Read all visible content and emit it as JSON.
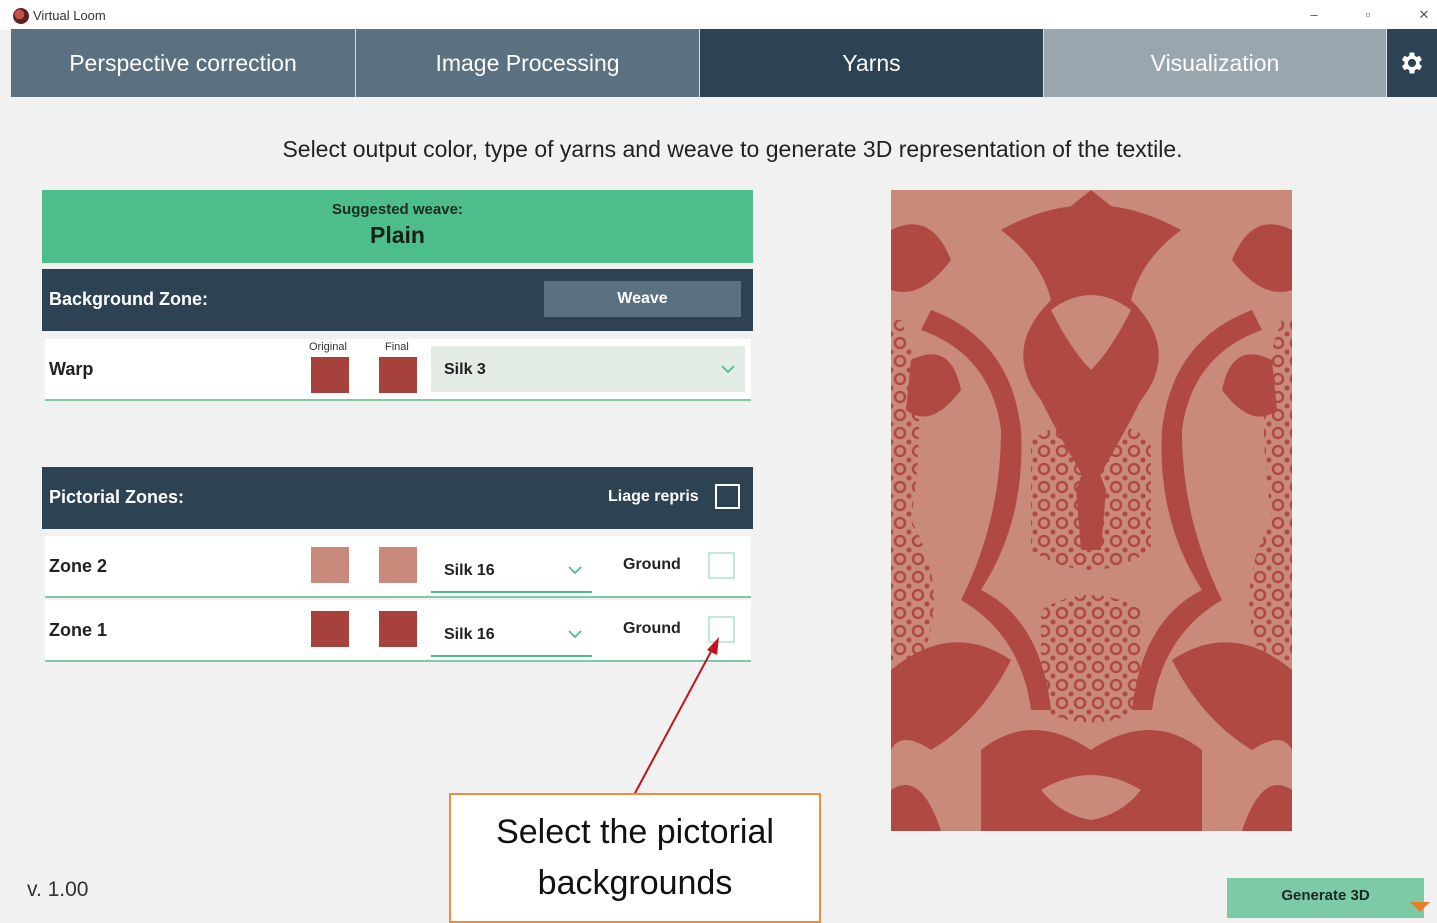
{
  "window": {
    "title": "Virtual Loom",
    "minimize_glyph": "–",
    "restore_glyph": "▫",
    "close_glyph": "✕"
  },
  "tabs": [
    {
      "label": "Perspective correction"
    },
    {
      "label": "Image Processing"
    },
    {
      "label": "Yarns"
    },
    {
      "label": "Visualization"
    }
  ],
  "settings": {
    "icon": "gear-icon"
  },
  "instruction": "Select output color, type of yarns and weave to generate 3D representation of the textile.",
  "suggested_weave": {
    "label": "Suggested weave:",
    "value": "Plain"
  },
  "background_zone": {
    "title": "Background Zone:",
    "weave_button": "Weave",
    "rows": [
      {
        "label": "Warp",
        "original_label": "Original",
        "final_label": "Final",
        "original_color": "#a6413c",
        "final_color": "#a6413c",
        "yarn": "Silk 3"
      }
    ]
  },
  "pictorial_zones": {
    "title": "Pictorial Zones:",
    "liage_label": "Liage repris",
    "rows": [
      {
        "label": "Zone 2",
        "original_color": "#c98a7c",
        "final_color": "#c98a7c",
        "yarn": "Silk 16",
        "ground_label": "Ground"
      },
      {
        "label": "Zone 1",
        "original_color": "#a6413c",
        "final_color": "#a6413c",
        "yarn": "Silk 16",
        "ground_label": "Ground"
      }
    ]
  },
  "annotation": {
    "line1": "Select the pictorial",
    "line2": "backgrounds"
  },
  "version": "v. 1.00",
  "generate_button": "Generate 3D",
  "colors": {
    "accent_green": "#4cbd8b",
    "header_dark": "#2d4252",
    "tab_mid": "#5b7081",
    "textile_dark": "#b04942",
    "textile_light": "#c98a7c"
  }
}
